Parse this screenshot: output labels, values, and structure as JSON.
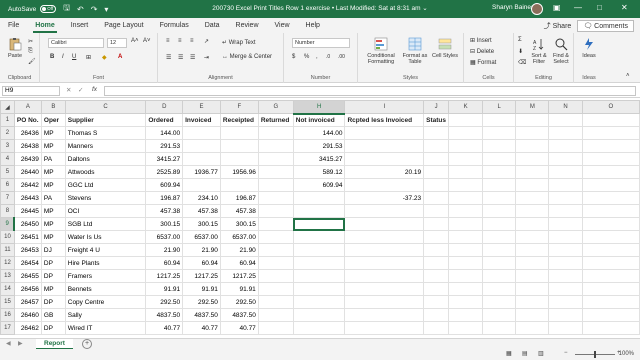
{
  "titlebar": {
    "autosave_label": "AutoSave",
    "autosave_state": "Off",
    "doc_title": "200730 Excel Print Titles Row 1 exercise  •  Last Modified: Sat at 8:31 am  ⌄",
    "user": "Sharyn Baines"
  },
  "tabs": [
    "File",
    "Home",
    "Insert",
    "Page Layout",
    "Formulas",
    "Data",
    "Review",
    "View",
    "Help"
  ],
  "share_label": "Share",
  "comments_label": "Comments",
  "ribbon": {
    "clipboard_label": "Clipboard",
    "paste_label": "Paste",
    "font_label": "Font",
    "font_name": "Calibri",
    "font_size": "12",
    "alignment_label": "Alignment",
    "wrap_text": "Wrap Text",
    "merge_center": "Merge & Center",
    "number_label": "Number",
    "number_format": "Number",
    "styles_label": "Styles",
    "conditional_formatting": "Conditional Formatting",
    "format_as_table": "Format as Table",
    "cell_styles": "Cell Styles",
    "cells_label": "Cells",
    "insert": "Insert",
    "delete": "Delete",
    "format": "Format",
    "editing_label": "Editing",
    "sort_filter": "Sort & Filter",
    "find_select": "Find & Select",
    "ideas_group_label": "Ideas",
    "ideas": "Ideas"
  },
  "namebox": "H9",
  "fx": "fx",
  "columns": [
    "A",
    "B",
    "C",
    "D",
    "E",
    "F",
    "G",
    "H",
    "I",
    "J",
    "K",
    "L",
    "M",
    "N",
    "O"
  ],
  "rows": [
    [
      "PO No.",
      "Oper",
      "Supplier",
      "Ordered",
      "Invoiced",
      "Receipted",
      "Returned",
      "Not invoiced",
      "Rcpted less Invoiced",
      "Status",
      "",
      "",
      "",
      "",
      ""
    ],
    [
      "26436",
      "MP",
      "Thomas S",
      "144.00",
      "",
      "",
      "",
      "144.00",
      "",
      "",
      "",
      "",
      "",
      "",
      ""
    ],
    [
      "26438",
      "MP",
      "Manners",
      "291.53",
      "",
      "",
      "",
      "291.53",
      "",
      "",
      "",
      "",
      "",
      "",
      ""
    ],
    [
      "26439",
      "PA",
      "Daltons",
      "3415.27",
      "",
      "",
      "",
      "3415.27",
      "",
      "",
      "",
      "",
      "",
      "",
      ""
    ],
    [
      "26440",
      "MP",
      "Attwoods",
      "2525.89",
      "1936.77",
      "1956.96",
      "",
      "589.12",
      "20.19",
      "",
      "",
      "",
      "",
      "",
      ""
    ],
    [
      "26442",
      "MP",
      "GGC Ltd",
      "609.94",
      "",
      "",
      "",
      "609.94",
      "",
      "",
      "",
      "",
      "",
      "",
      ""
    ],
    [
      "26443",
      "PA",
      "Stevens",
      "196.87",
      "234.10",
      "196.87",
      "",
      "",
      "-37.23",
      "",
      "",
      "",
      "",
      "",
      ""
    ],
    [
      "26445",
      "MP",
      "OCI",
      "457.38",
      "457.38",
      "457.38",
      "",
      "",
      "",
      "",
      "",
      "",
      "",
      "",
      ""
    ],
    [
      "26450",
      "MP",
      "SGB Ltd",
      "300.15",
      "300.15",
      "300.15",
      "",
      "",
      "",
      "",
      "",
      "",
      "",
      "",
      ""
    ],
    [
      "26451",
      "MP",
      "Water Is Us",
      "6537.00",
      "6537.00",
      "6537.00",
      "",
      "",
      "",
      "",
      "",
      "",
      "",
      "",
      ""
    ],
    [
      "26453",
      "DJ",
      "Freight 4 U",
      "21.90",
      "21.90",
      "21.90",
      "",
      "",
      "",
      "",
      "",
      "",
      "",
      "",
      ""
    ],
    [
      "26454",
      "DP",
      "Hire Plants",
      "60.94",
      "60.94",
      "60.94",
      "",
      "",
      "",
      "",
      "",
      "",
      "",
      "",
      ""
    ],
    [
      "26455",
      "DP",
      "Framers",
      "1217.25",
      "1217.25",
      "1217.25",
      "",
      "",
      "",
      "",
      "",
      "",
      "",
      "",
      ""
    ],
    [
      "26456",
      "MP",
      "Bennets",
      "91.91",
      "91.91",
      "91.91",
      "",
      "",
      "",
      "",
      "",
      "",
      "",
      "",
      ""
    ],
    [
      "26457",
      "DP",
      "Copy Centre",
      "292.50",
      "292.50",
      "292.50",
      "",
      "",
      "",
      "",
      "",
      "",
      "",
      "",
      ""
    ],
    [
      "26460",
      "GB",
      "Sally",
      "4837.50",
      "4837.50",
      "4837.50",
      "",
      "",
      "",
      "",
      "",
      "",
      "",
      "",
      ""
    ],
    [
      "26462",
      "DP",
      "Wired IT",
      "40.77",
      "40.77",
      "40.77",
      "",
      "",
      "",
      "",
      "",
      "",
      "",
      "",
      ""
    ]
  ],
  "sheet_tab": "Report",
  "zoom": "100%"
}
